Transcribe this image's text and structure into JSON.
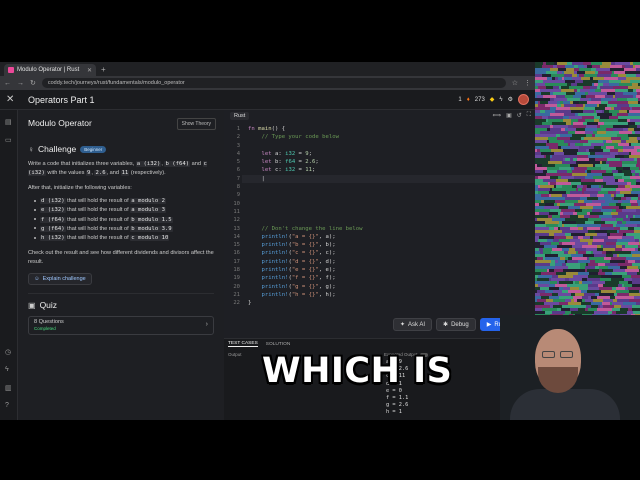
{
  "browser": {
    "tab_title": "Modulo Operator | Rust",
    "new_tab": "+",
    "url": "coddy.tech/journeys/rust/fundamentals/modulo_operator"
  },
  "header": {
    "close": "✕",
    "title": "Operators Part 1",
    "streak": "1",
    "gems": "273"
  },
  "challenge": {
    "lesson_title": "Modulo Operator",
    "show_theory": "Show Theory",
    "heading": "Challenge",
    "badge": "Beginner",
    "intro": [
      "Write a code that initializes three variables, ",
      "a (i32)",
      ", ",
      "b (f64)",
      " and ",
      "c (i32)",
      " with the values ",
      "9",
      ", ",
      "2.6",
      ", and ",
      "11",
      " (respectively)."
    ],
    "after_text": "After that, initialize the following variables:",
    "items": [
      {
        "var": "d (i32)",
        "text": " that will hold the result of ",
        "expr": "a modulo 2"
      },
      {
        "var": "e (i32)",
        "text": " that will hold the result of ",
        "expr": "a modulo 3"
      },
      {
        "var": "f (f64)",
        "text": " that will hold the result of ",
        "expr": "b modulo 1.5"
      },
      {
        "var": "g (f64)",
        "text": " that will hold the result of ",
        "expr": "b modulo 3.9"
      },
      {
        "var": "h (i32)",
        "text": " that will hold the result of ",
        "expr": "c modulo 10"
      }
    ],
    "check_text": "Check out the result and see how different dividends and divisors affect the result.",
    "explain_button": "Explain challenge"
  },
  "quiz": {
    "heading": "Quiz",
    "questions": "8 Questions",
    "status": "Completed"
  },
  "editor": {
    "tab": "Rust",
    "line_numbers": [
      "1",
      "2",
      "3",
      "4",
      "5",
      "6",
      "7",
      "8",
      "9",
      "10",
      "11",
      "12",
      "13",
      "14",
      "15",
      "16",
      "17",
      "18",
      "19",
      "20",
      "21",
      "22"
    ],
    "buttons": {
      "ask_ai": "Ask AI",
      "debug": "Debug",
      "run": "Ru"
    }
  },
  "bottom": {
    "tab_tests": "TEST CASES",
    "tab_solution": "SOLUTION",
    "output_label": "Output",
    "expected_label": "Expected Output",
    "expected_lines": [
      "a = 9",
      "b = 2.6",
      "c = 11",
      "d = 1",
      "e = 0",
      "f = 1.1",
      "g = 2.6",
      "h = 1"
    ]
  },
  "caption": "WHICH IS",
  "colors": {
    "accent": "#2563eb",
    "badge": "#2f5e8f",
    "completed": "#4ade80"
  }
}
